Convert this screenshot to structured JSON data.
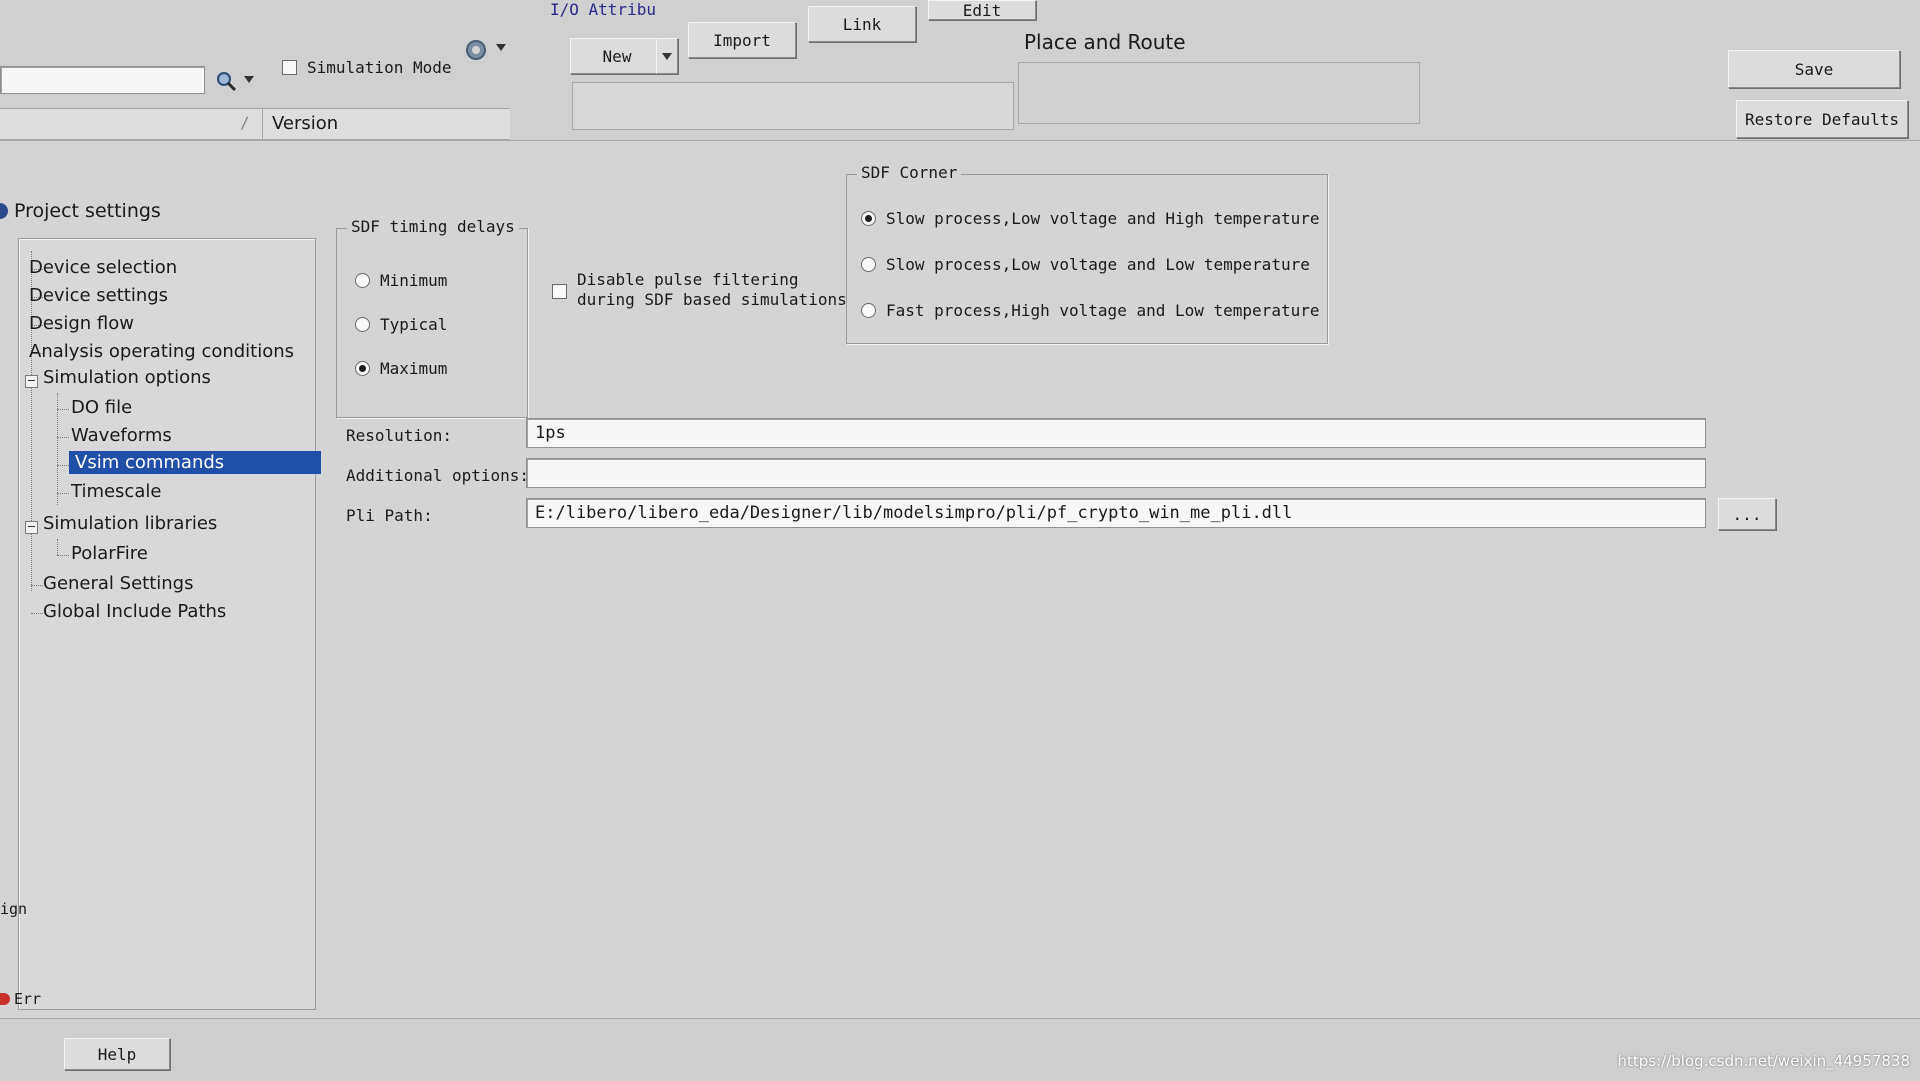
{
  "toolbar": {
    "io_attributes_label": "I/O Attribu",
    "simulation_mode_label": "Simulation Mode",
    "simulation_mode_checked": false,
    "new_label": "New",
    "import_label": "Import",
    "link_label": "Link",
    "edit_label": "Edit",
    "place_and_route_label": "Place and Route",
    "search_icon": "search-icon",
    "gear_icon": "gear-icon"
  },
  "design_table": {
    "version_header": "Version",
    "separator": "/"
  },
  "right_buttons": {
    "save_label": "Save",
    "restore_defaults_label": "Restore Defaults"
  },
  "sidebar": {
    "title": "Project settings",
    "items": [
      {
        "label": "Device selection"
      },
      {
        "label": "Device settings"
      },
      {
        "label": "Design flow"
      },
      {
        "label": "Analysis operating conditions"
      },
      {
        "label": "Simulation options"
      },
      {
        "label": "DO file"
      },
      {
        "label": "Waveforms"
      },
      {
        "label": "Vsim commands"
      },
      {
        "label": "Timescale"
      },
      {
        "label": "Simulation libraries"
      },
      {
        "label": "PolarFire"
      },
      {
        "label": "General Settings"
      },
      {
        "label": "Global Include Paths"
      }
    ],
    "selected": "Vsim commands"
  },
  "sdf_timing": {
    "legend": "SDF timing delays",
    "options": [
      {
        "label": "Minimum",
        "selected": false
      },
      {
        "label": "Typical",
        "selected": false
      },
      {
        "label": "Maximum",
        "selected": true
      }
    ]
  },
  "pulse_filter": {
    "line1": "Disable pulse filtering",
    "line2": "during SDF based simulations",
    "checked": false
  },
  "sdf_corner": {
    "legend": "SDF Corner",
    "options": [
      {
        "label": "Slow process,Low voltage and High temperature",
        "selected": true
      },
      {
        "label": "Slow process,Low voltage and Low temperature",
        "selected": false
      },
      {
        "label": "Fast process,High voltage and Low temperature",
        "selected": false
      }
    ]
  },
  "form": {
    "resolution_label": "Resolution:",
    "resolution_value": "1ps",
    "additional_options_label": "Additional options:",
    "additional_options_value": "",
    "pli_path_label": "Pli Path:",
    "pli_path_value": "E:/libero/libero_eda/Designer/lib/modelsimpro/pli/pf_crypto_win_me_pli.dll",
    "browse_label": "..."
  },
  "bottom": {
    "help_label": "Help",
    "sign_fragment": "ign",
    "err_fragment": "Err"
  },
  "watermark": "https://blog.csdn.net/weixin_44957838"
}
